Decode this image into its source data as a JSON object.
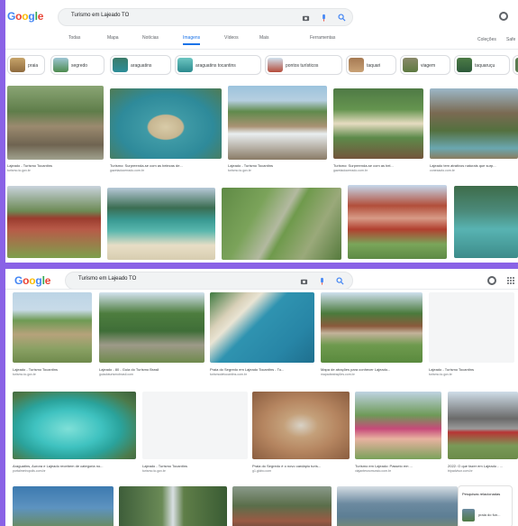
{
  "top_window": {
    "logo": [
      "G",
      "o",
      "o",
      "g",
      "l",
      "e"
    ],
    "query": "Turismo em Lajeado TO",
    "tabs": [
      "Todas",
      "Mapa",
      "Notícias",
      "Imagens",
      "Vídeos",
      "Mais"
    ],
    "active_tab": "Imagens",
    "tools": "Ferramentas",
    "collections": "Coleções",
    "safesearch": "Safe",
    "chips": [
      "praia",
      "segredo",
      "araguatins",
      "araguatins tocantins",
      "pontos turísticos",
      "taquari",
      "viagem",
      "taquaruçu"
    ],
    "row1": [
      {
        "caption": "Lajeado - Turismo Tocantins",
        "source": "turismo.to.gov.br"
      },
      {
        "caption": "Turismo: Surpreenda-se com as belezas de...",
        "source": "gazetadocerrado.com.br"
      },
      {
        "caption": "Lajeado - Turismo Tocantins",
        "source": "turismo.to.gov.br"
      },
      {
        "caption": "Turismo: Surpreenda-se com as bel...",
        "source": "gazetadocerrado.com.br"
      },
      {
        "caption": "Lajeado tem atrativos naturais que surp...",
        "source": "conexaoto.com.br"
      }
    ]
  },
  "bottom_window": {
    "logo": [
      "G",
      "o",
      "o",
      "g",
      "l",
      "e"
    ],
    "query": "Turismo em Lajeado TO",
    "row1": [
      {
        "caption": "Lajeado - Turismo Tocantins",
        "source": "turismo.to.gov.br"
      },
      {
        "caption": "Lajeado - 80 - Guia do Turismo Brasil",
        "source": "guiadoturismobrasil.com"
      },
      {
        "caption": "Praia do Segredo em Lajeado Tocantins - Tu...",
        "source": "turismodetocantins.com.br"
      },
      {
        "caption": "Mapa de atrações para conhecer Lajeado...",
        "source": "mapadeatrações.com.br"
      },
      {
        "caption": "Lajeado - Turismo Tocantins",
        "source": "turismo.to.gov.br"
      }
    ],
    "row2": [
      {
        "caption": "Araguatins, Aurora e Lajeado recebem de categoria no...",
        "source": "portalmetropolis.com.br"
      },
      {
        "caption": "Lajeado - Turismo Tocantins",
        "source": "turismo.to.gov.br"
      },
      {
        "caption": "Praia do Segredo é o novo cardápio turís...",
        "source": "g1.globo.com"
      },
      {
        "caption": "Turismo em Lajeado: Passeio em ...",
        "source": "viajantesnomundo.com.br"
      },
      {
        "caption": "2022: O que fazer em Lajeado - ...",
        "source": "tripadvisor.com.br"
      }
    ],
    "related_title": "Pesquisas relacionadas",
    "related_item": "praia do fun..."
  },
  "colors": {
    "accent": "#1a73e8",
    "frame": "#8a62e6",
    "background": "#ffffff"
  }
}
